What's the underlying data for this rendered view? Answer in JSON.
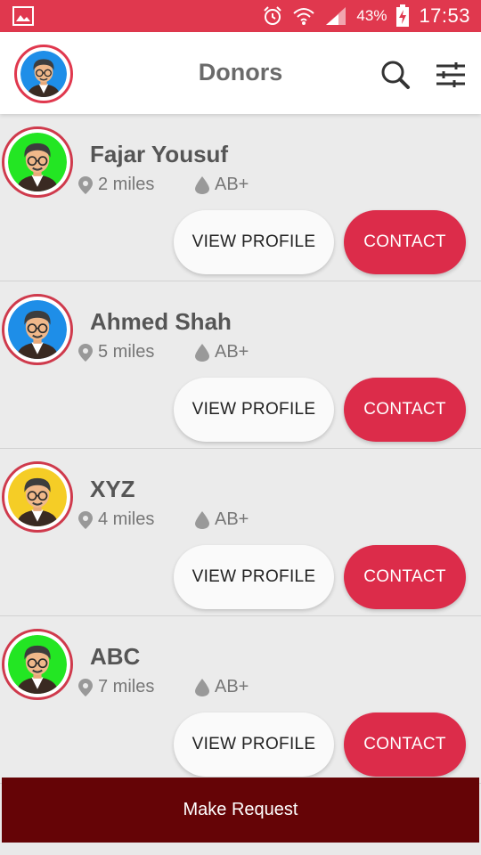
{
  "status_bar": {
    "battery_pct": "43%",
    "time": "17:53",
    "icons": [
      "gallery-icon",
      "alarm-icon",
      "wifi-icon",
      "signal-icon",
      "battery-charging-icon"
    ]
  },
  "header": {
    "title": "Donors",
    "icons": [
      "search-icon",
      "filter-icon"
    ]
  },
  "donors": [
    {
      "name": "Fajar Yousuf",
      "distance": "2 miles",
      "blood_group": "AB+",
      "avatar_bg": "#23e623",
      "view_label": "VIEW PROFILE",
      "contact_label": "CONTACT"
    },
    {
      "name": "Ahmed Shah",
      "distance": "5 miles",
      "blood_group": "AB+",
      "avatar_bg": "#1e8ee8",
      "view_label": "VIEW PROFILE",
      "contact_label": "CONTACT"
    },
    {
      "name": "XYZ",
      "distance": "4 miles",
      "blood_group": "AB+",
      "avatar_bg": "#f5cd26",
      "view_label": "VIEW PROFILE",
      "contact_label": "CONTACT"
    },
    {
      "name": "ABC",
      "distance": "7 miles",
      "blood_group": "AB+",
      "avatar_bg": "#23e623",
      "view_label": "VIEW PROFILE",
      "contact_label": "CONTACT"
    }
  ],
  "footer": {
    "make_request_label": "Make Request"
  },
  "colors": {
    "accent": "#dc2c4a",
    "status_bar": "#e0384e",
    "footer": "#650406",
    "header_avatar_bg": "#1e8ee8"
  }
}
